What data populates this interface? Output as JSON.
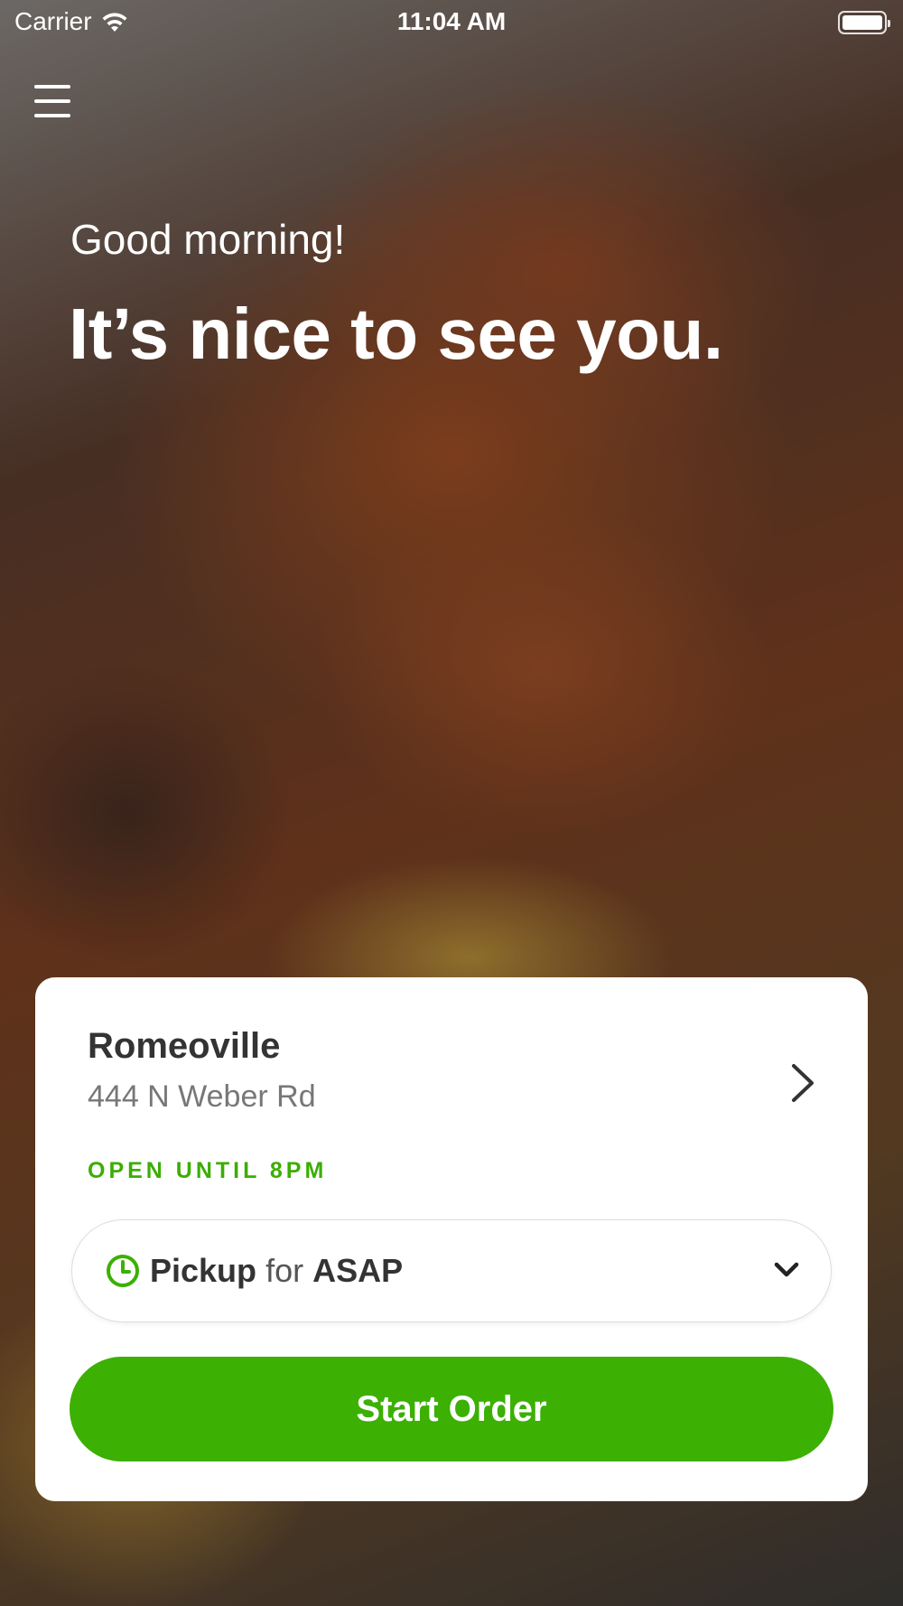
{
  "status_bar": {
    "carrier": "Carrier",
    "time": "11:04 AM"
  },
  "header": {
    "greeting": "Good morning!",
    "headline": "It’s nice to see you."
  },
  "location_card": {
    "name": "Romeoville",
    "address": "444 N Weber Rd",
    "open_status": "OPEN UNTIL 8PM",
    "order_mode": "Pickup",
    "connector": "for",
    "order_time": "ASAP",
    "start_button_label": "Start Order"
  },
  "colors": {
    "accent_green": "#3cb003",
    "open_status_green": "#3cad04",
    "card_background": "#ffffff"
  },
  "icons": [
    "wifi-icon",
    "battery-icon",
    "menu-icon",
    "chevron-right-icon",
    "clock-icon",
    "chevron-down-icon"
  ]
}
